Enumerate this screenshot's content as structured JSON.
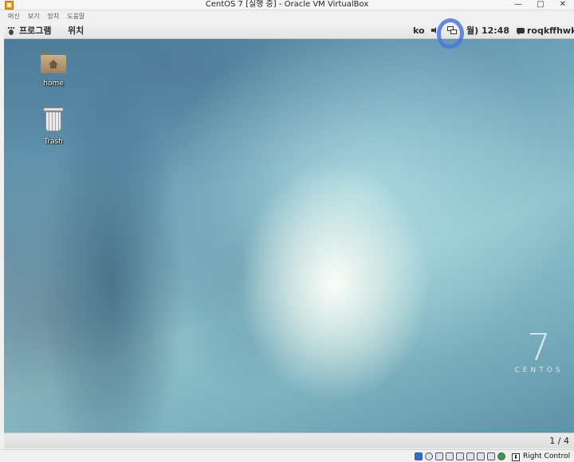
{
  "window": {
    "title": "CentOS 7 [실행 중] - Oracle VM VirtualBox",
    "controls": [
      "—",
      "□",
      "✕"
    ]
  },
  "host_menu": [
    "머신",
    "보기",
    "장치",
    "도움말"
  ],
  "guest_panel": {
    "applications": "프로그램",
    "places": "위치",
    "input_method": "ko",
    "clock": "월) 12:48",
    "user": "roqkffhwk"
  },
  "desktop": {
    "icons": [
      {
        "label": "home",
        "icon": "home-folder-icon"
      },
      {
        "label": "Trash",
        "icon": "trash-icon"
      }
    ],
    "logo": {
      "digit": "7",
      "word": "CENTOS"
    }
  },
  "guest_bottom": {
    "workspace_pager": "1 / 4"
  },
  "status_bar": {
    "host_key": "Right Control"
  },
  "colors": {
    "highlight_ring": "#4a78d8",
    "panel": "#e8e8e8"
  }
}
